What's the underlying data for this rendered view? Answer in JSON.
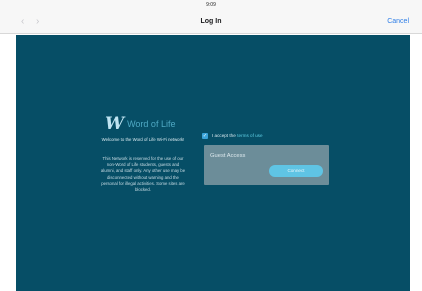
{
  "status_bar": {
    "time": "9:09"
  },
  "nav": {
    "back_glyph": "‹",
    "forward_glyph": "›",
    "title": "Log In",
    "cancel_label": "Cancel"
  },
  "brand": {
    "logo_glyph": "W",
    "name": "Word of Life"
  },
  "welcome_text": "Welcome to the Word of Life Wi-Fi network!",
  "notice_text": "This Network is reserved for the use of our non-Word of Life students, guests and alumni, and staff only. Any other use may be disconnected without warning and the personal for illegal activities. Some sites are blocked.",
  "terms": {
    "checked": true,
    "check_glyph": "✓",
    "label": "I accept the",
    "link_text": "terms of use"
  },
  "login": {
    "heading": "Guest Access",
    "connect_label": "Connect"
  },
  "colors": {
    "portal_bg": "#064e66",
    "accent": "#5fc4e4",
    "nav_link": "#2d7de6"
  }
}
